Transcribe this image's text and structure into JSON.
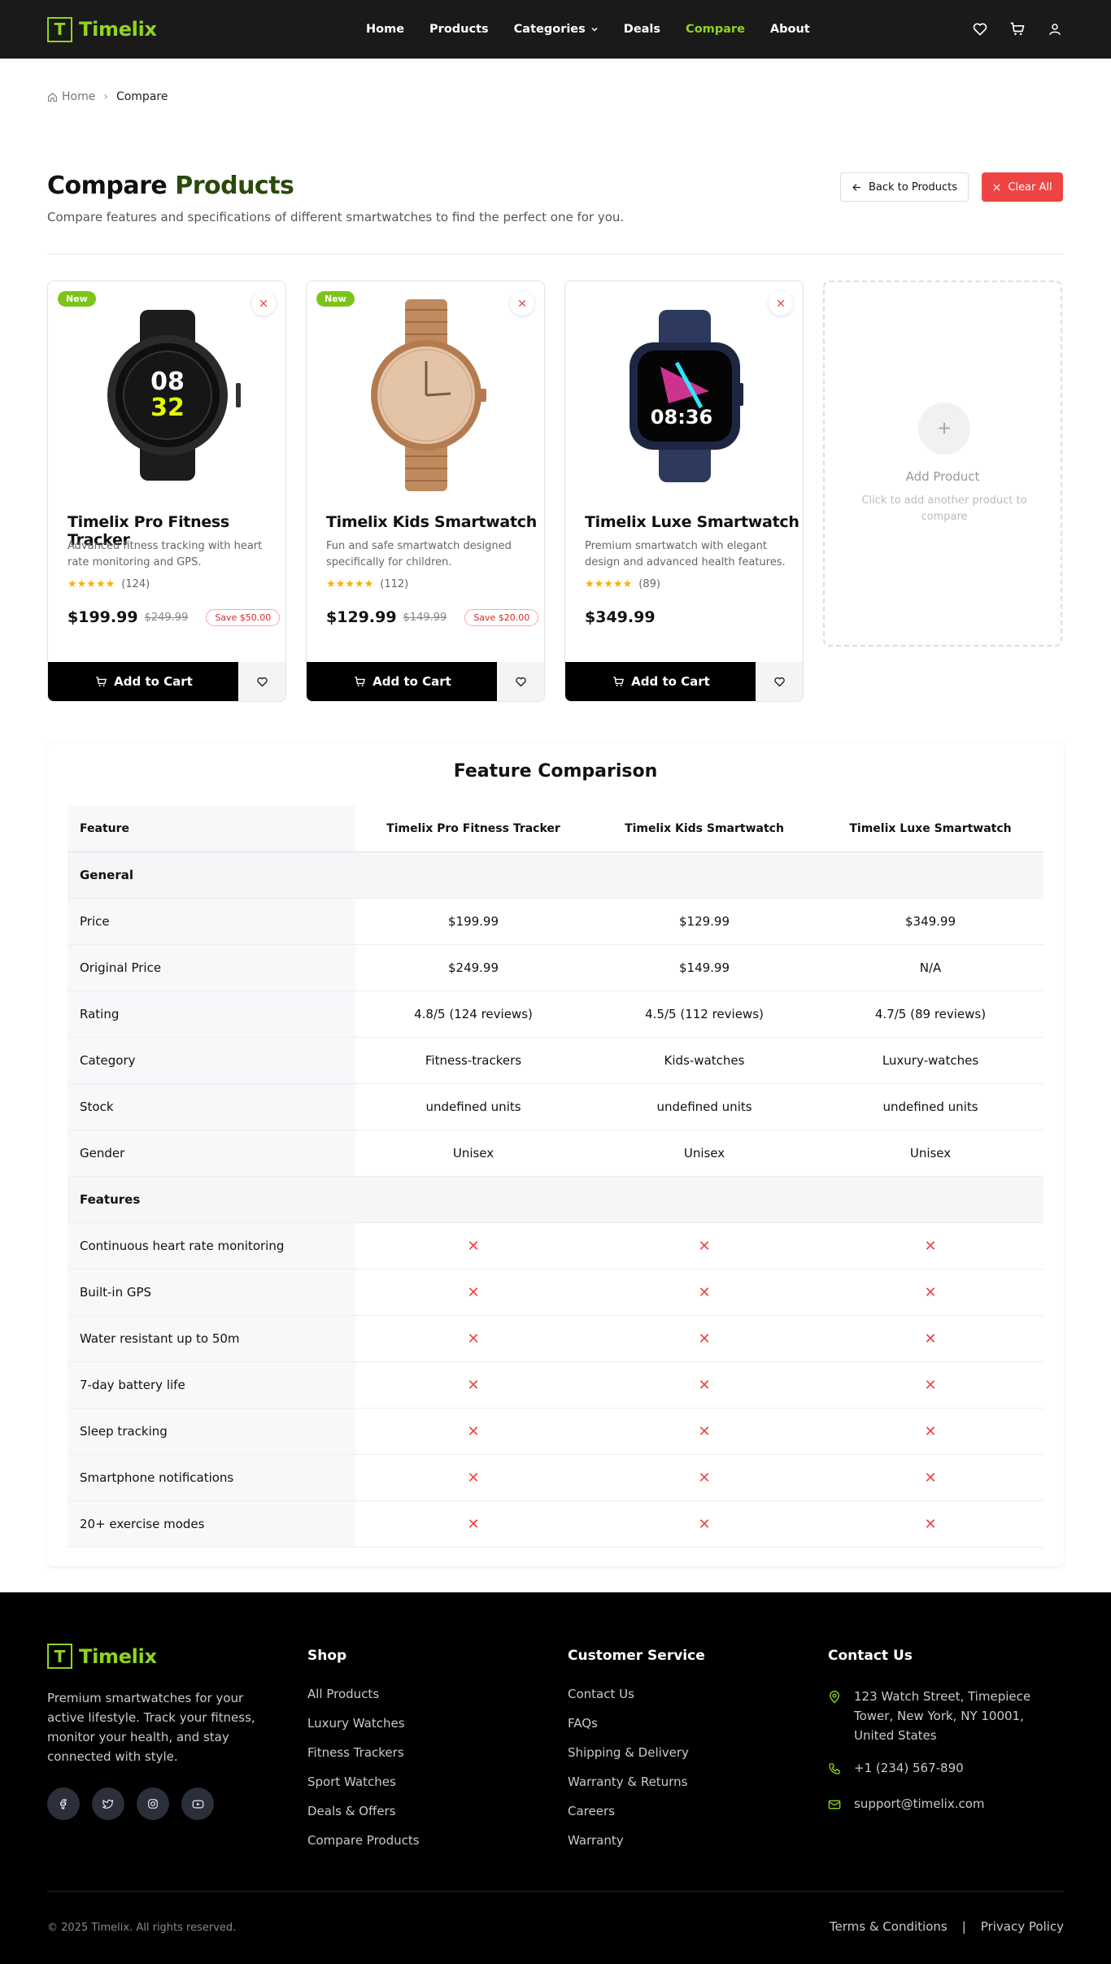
{
  "brand": {
    "logo_letter": "T",
    "name": "Timelix",
    "accent_color": "#8fd41f"
  },
  "nav": {
    "items": [
      {
        "label": "Home"
      },
      {
        "label": "Products"
      },
      {
        "label": "Categories"
      },
      {
        "label": "Deals"
      },
      {
        "label": "Compare"
      },
      {
        "label": "About"
      }
    ],
    "active": "Compare"
  },
  "header_icons": [
    "heart-icon",
    "cart-icon",
    "user-icon"
  ],
  "breadcrumb": {
    "home": "Home",
    "current": "Compare"
  },
  "page": {
    "title_part1": "Compare",
    "title_part2": "Products",
    "subtitle": "Compare features and specifications of different smartwatches to find the perfect one for you.",
    "back_label": "Back to Products",
    "clear_label": "Clear All"
  },
  "products": [
    {
      "badge": "New",
      "name": "Timelix Pro Fitness Tracker",
      "desc": "Advanced fitness tracking with heart rate monitoring and GPS.",
      "stars": "★★★★★",
      "reviews": "(124)",
      "price": "$199.99",
      "orig": "$249.99",
      "save": "Save $50.00",
      "cart_label": "Add to Cart"
    },
    {
      "badge": "New",
      "name": "Timelix Kids Smartwatch",
      "desc": "Fun and safe smartwatch designed specifically for children.",
      "stars": "★★★★★",
      "reviews": "(112)",
      "price": "$129.99",
      "orig": "$149.99",
      "save": "Save $20.00",
      "cart_label": "Add to Cart"
    },
    {
      "badge": "",
      "name": "Timelix Luxe Smartwatch",
      "desc": "Premium smartwatch with elegant design and advanced health features.",
      "stars": "★★★★★",
      "reviews": "(89)",
      "price": "$349.99",
      "orig": "",
      "save": "",
      "cart_label": "Add to Cart"
    }
  ],
  "add_card": {
    "title": "Add Product",
    "desc": "Click to add another product to compare"
  },
  "comparison": {
    "title": "Feature Comparison",
    "header": [
      "Feature",
      "Timelix Pro Fitness Tracker",
      "Timelix Kids Smartwatch",
      "Timelix Luxe Smartwatch"
    ],
    "general_label": "General",
    "general_rows": [
      {
        "feature": "Price",
        "values": [
          "$199.99",
          "$129.99",
          "$349.99"
        ]
      },
      {
        "feature": "Original Price",
        "values": [
          "$249.99",
          "$149.99",
          "N/A"
        ]
      },
      {
        "feature": "Rating",
        "values": [
          "4.8/5 (124 reviews)",
          "4.5/5 (112 reviews)",
          "4.7/5 (89 reviews)"
        ]
      },
      {
        "feature": "Category",
        "values": [
          "Fitness-trackers",
          "Kids-watches",
          "Luxury-watches"
        ]
      },
      {
        "feature": "Stock",
        "values": [
          "undefined units",
          "undefined units",
          "undefined units"
        ]
      },
      {
        "feature": "Gender",
        "values": [
          "Unisex",
          "Unisex",
          "Unisex"
        ]
      }
    ],
    "features_label": "Features",
    "feature_rows": [
      "Continuous heart rate monitoring",
      "Built-in GPS",
      "Water resistant up to 50m",
      "7-day battery life",
      "Sleep tracking",
      "Smartphone notifications",
      "20+ exercise modes"
    ],
    "x_mark": "✕"
  },
  "footer": {
    "about": "Premium smartwatches for your active lifestyle. Track your fitness, monitor your health, and stay connected with style.",
    "social": [
      "facebook-icon",
      "twitter-icon",
      "instagram-icon",
      "youtube-icon"
    ],
    "shop_title": "Shop",
    "shop_links": [
      "All Products",
      "Luxury Watches",
      "Fitness Trackers",
      "Sport Watches",
      "Deals & Offers",
      "Compare Products"
    ],
    "service_title": "Customer Service",
    "service_links": [
      "Contact Us",
      "FAQs",
      "Shipping & Delivery",
      "Warranty & Returns",
      "Careers",
      "Warranty"
    ],
    "contact_title": "Contact Us",
    "address": "123 Watch Street, Timepiece Tower, New York, NY 10001, United States",
    "phone": "+1 (234) 567-890",
    "email": "support@timelix.com",
    "copyright": "© 2025 Timelix. All rights reserved.",
    "terms": "Terms & Conditions",
    "legal_sep": "|",
    "privacy": "Privacy Policy"
  }
}
